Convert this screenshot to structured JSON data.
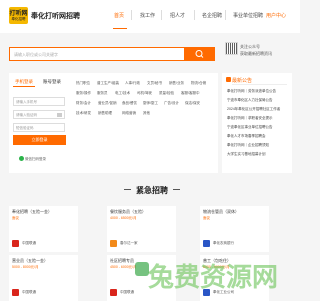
{
  "header": {
    "logo_text": "打听网",
    "logo_sub": "奉化招聘",
    "site_name": "奉化打听网招聘",
    "nav": [
      "首页",
      "找工作",
      "招人才",
      "名企招聘",
      "事业单位招聘"
    ],
    "user_center": "用户中心"
  },
  "search": {
    "placeholder": "请输入职位或公司关键字",
    "wechat_line1": "关注公众号",
    "wechat_line2": "获取最新招聘资讯"
  },
  "login": {
    "tab_phone": "手机登录",
    "tab_account": "账号登录",
    "phone_placeholder": "请输入手机号",
    "code_placeholder": "请输入验证码",
    "sms_placeholder": "短信验证码",
    "login_button": "立即登录",
    "wechat_login": "微信扫码登录"
  },
  "categories": [
    "热门职位",
    "普工生产/组装",
    "人事/行政",
    "文员/秘书",
    "销售/业务",
    "物流/仓储",
    "服务/操作",
    "服务员",
    "电工/技术",
    "司机/驾驶",
    "质量/检验",
    "客服/客服中",
    "财务/会计",
    "营业员/促销",
    "食品/餐饮",
    "厨师/厨工",
    "广告/设计",
    "保洁/保安",
    "技术/研发",
    "销售助理",
    "网络营销",
    "其他"
  ],
  "notices": {
    "title": "最新公告",
    "items": [
      "奉化打听网｜劳务派遣单位公告",
      "宁波市奉化区人力社保局公告",
      "2024年奉化区公开招聘社区工作者",
      "奉化打听网｜求职者安全提示",
      "宁波奉化区事业单位招聘公告",
      "奉化人才市场春季招聘会",
      "奉化打听网｜企业招聘须知",
      "大学生实习基地招募计划"
    ]
  },
  "urgent": {
    "title": "紧急招聘",
    "cards": [
      {
        "title": "奉化招聘（五险一金）",
        "salary": "面议",
        "company": "中国联通",
        "icon_color": "#d9251c"
      },
      {
        "title": "餐饮服务员（五险）",
        "salary": "4000 - 6500元/月",
        "company": "春尔达一家",
        "icon_color": "#f28a1a"
      },
      {
        "title": "物流仓管员（双休）",
        "salary": "面议",
        "company": "奉化农商银行",
        "icon_color": "#2a56c6"
      },
      {
        "title": "营业员（五险一金）",
        "salary": "5000 - 8000元/月",
        "company": "中国联通",
        "icon_color": "#d9251c"
      },
      {
        "title": "社区招聘专员",
        "salary": "4500 - 6000元/月",
        "company": "中国联通",
        "icon_color": "#d9251c"
      },
      {
        "title": "普工（包吃住）",
        "salary": "6000 - 9000元/月",
        "company": "奉化工业公司",
        "icon_color": "#2a56c6"
      }
    ]
  },
  "watermark": "兔费资源网",
  "colors": {
    "accent": "#ff6a00",
    "watermark": "#5fbf4a"
  }
}
